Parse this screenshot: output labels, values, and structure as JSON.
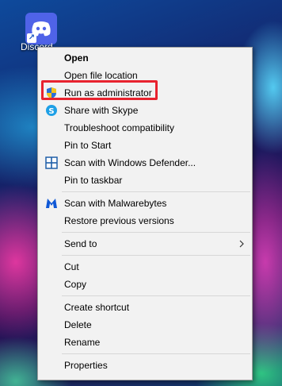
{
  "desktop": {
    "shortcut_label": "Discord",
    "shortcut_icon": "discord-icon"
  },
  "context_menu": {
    "items": [
      {
        "label": "Open",
        "icon": null
      },
      {
        "label": "Open file location",
        "icon": null
      },
      {
        "label": "Run as administrator",
        "icon": "uac-shield-icon"
      },
      {
        "label": "Share with Skype",
        "icon": "skype-icon"
      },
      {
        "label": "Troubleshoot compatibility",
        "icon": null
      },
      {
        "label": "Pin to Start",
        "icon": null
      },
      {
        "label": "Scan with Windows Defender...",
        "icon": "windows-defender-icon"
      },
      {
        "label": "Pin to taskbar",
        "icon": null
      },
      {
        "label": "Scan with Malwarebytes",
        "icon": "malwarebytes-icon"
      },
      {
        "label": "Restore previous versions",
        "icon": null
      },
      {
        "label": "Send to",
        "icon": null,
        "submenu": true
      },
      {
        "label": "Cut",
        "icon": null
      },
      {
        "label": "Copy",
        "icon": null
      },
      {
        "label": "Create shortcut",
        "icon": null
      },
      {
        "label": "Delete",
        "icon": null
      },
      {
        "label": "Rename",
        "icon": null
      },
      {
        "label": "Properties",
        "icon": null
      }
    ]
  },
  "annotation": {
    "highlighted_item": "Run as administrator",
    "highlight_color": "#e8232f"
  }
}
